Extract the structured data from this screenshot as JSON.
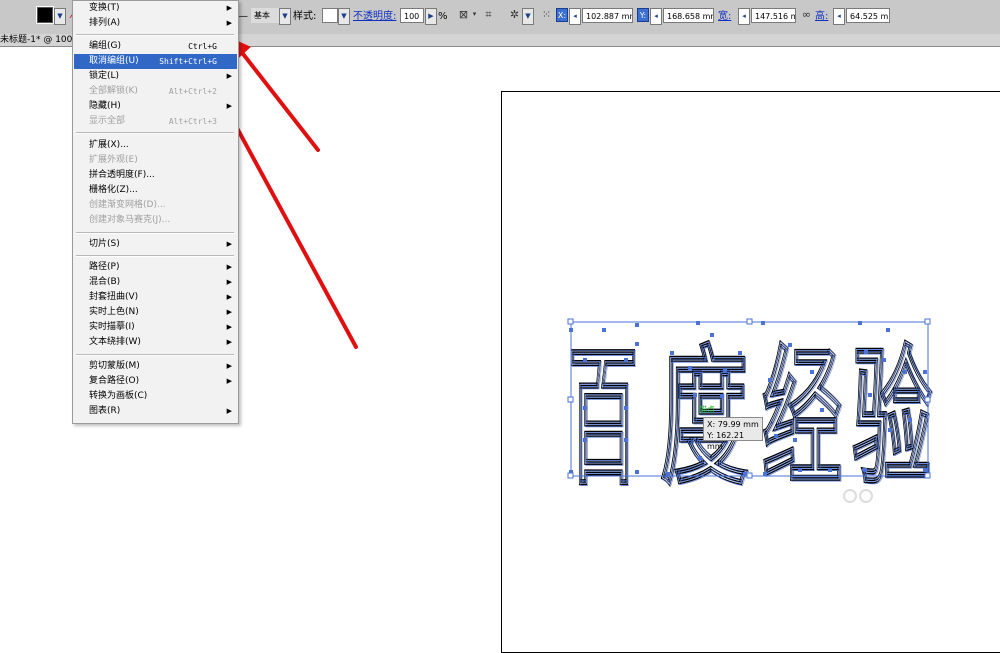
{
  "controlbar": {
    "stroke_style": "基本",
    "style_label": "样式:",
    "opacity_label": "不透明度:",
    "opacity_value": "100",
    "percent": "%",
    "x_label": "X:",
    "x_value": "102.887 mm",
    "y_label": "Y:",
    "y_value": "168.658 mm",
    "w_label": "宽:",
    "w_value": "147.516 mi",
    "h_label": "高:",
    "h_value": "64.525 mm"
  },
  "document": {
    "tab_title": "未标题-1* @ 100"
  },
  "menu": {
    "items": [
      {
        "label": "变换(T)",
        "shortcut": "",
        "submenu": true,
        "disabled": false
      },
      {
        "label": "排列(A)",
        "shortcut": "",
        "submenu": true,
        "disabled": false
      },
      {
        "label": "编组(G)",
        "shortcut": "Ctrl+G",
        "submenu": false,
        "disabled": false
      },
      {
        "label": "取消编组(U)",
        "shortcut": "Shift+Ctrl+G",
        "submenu": false,
        "disabled": false,
        "highlighted": true
      },
      {
        "label": "锁定(L)",
        "shortcut": "",
        "submenu": true,
        "disabled": false
      },
      {
        "label": "全部解锁(K)",
        "shortcut": "Alt+Ctrl+2",
        "submenu": false,
        "disabled": true
      },
      {
        "label": "隐藏(H)",
        "shortcut": "",
        "submenu": true,
        "disabled": false
      },
      {
        "label": "显示全部",
        "shortcut": "Alt+Ctrl+3",
        "submenu": false,
        "disabled": true
      },
      {
        "label": "扩展(X)...",
        "shortcut": "",
        "submenu": false,
        "disabled": false
      },
      {
        "label": "扩展外观(E)",
        "shortcut": "",
        "submenu": false,
        "disabled": true
      },
      {
        "label": "拼合透明度(F)...",
        "shortcut": "",
        "submenu": false,
        "disabled": false
      },
      {
        "label": "栅格化(Z)...",
        "shortcut": "",
        "submenu": false,
        "disabled": false
      },
      {
        "label": "创建渐变网格(D)...",
        "shortcut": "",
        "submenu": false,
        "disabled": true
      },
      {
        "label": "创建对象马赛克(J)...",
        "shortcut": "",
        "submenu": false,
        "disabled": true
      },
      {
        "label": "切片(S)",
        "shortcut": "",
        "submenu": true,
        "disabled": false
      },
      {
        "label": "路径(P)",
        "shortcut": "",
        "submenu": true,
        "disabled": false
      },
      {
        "label": "混合(B)",
        "shortcut": "",
        "submenu": true,
        "disabled": false
      },
      {
        "label": "封套扭曲(V)",
        "shortcut": "",
        "submenu": true,
        "disabled": false
      },
      {
        "label": "实时上色(N)",
        "shortcut": "",
        "submenu": true,
        "disabled": false
      },
      {
        "label": "实时描摹(I)",
        "shortcut": "",
        "submenu": true,
        "disabled": false
      },
      {
        "label": "文本绕排(W)",
        "shortcut": "",
        "submenu": true,
        "disabled": false
      },
      {
        "label": "剪切蒙版(M)",
        "shortcut": "",
        "submenu": true,
        "disabled": false
      },
      {
        "label": "复合路径(O)",
        "shortcut": "",
        "submenu": true,
        "disabled": false
      },
      {
        "label": "转换为画板(C)",
        "shortcut": "",
        "submenu": false,
        "disabled": false
      },
      {
        "label": "图表(R)",
        "shortcut": "",
        "submenu": true,
        "disabled": false
      }
    ]
  },
  "canvas": {
    "artwork_text": [
      "百",
      "度",
      "经",
      "验"
    ],
    "smart_guide_label": "锚点",
    "tooltip_x": "X: 79.99 mm",
    "tooltip_y": "Y: 162.21 mm"
  },
  "colors": {
    "selection": "#4a72d8",
    "highlight": "#3168c6",
    "arrow": "#e01010"
  }
}
